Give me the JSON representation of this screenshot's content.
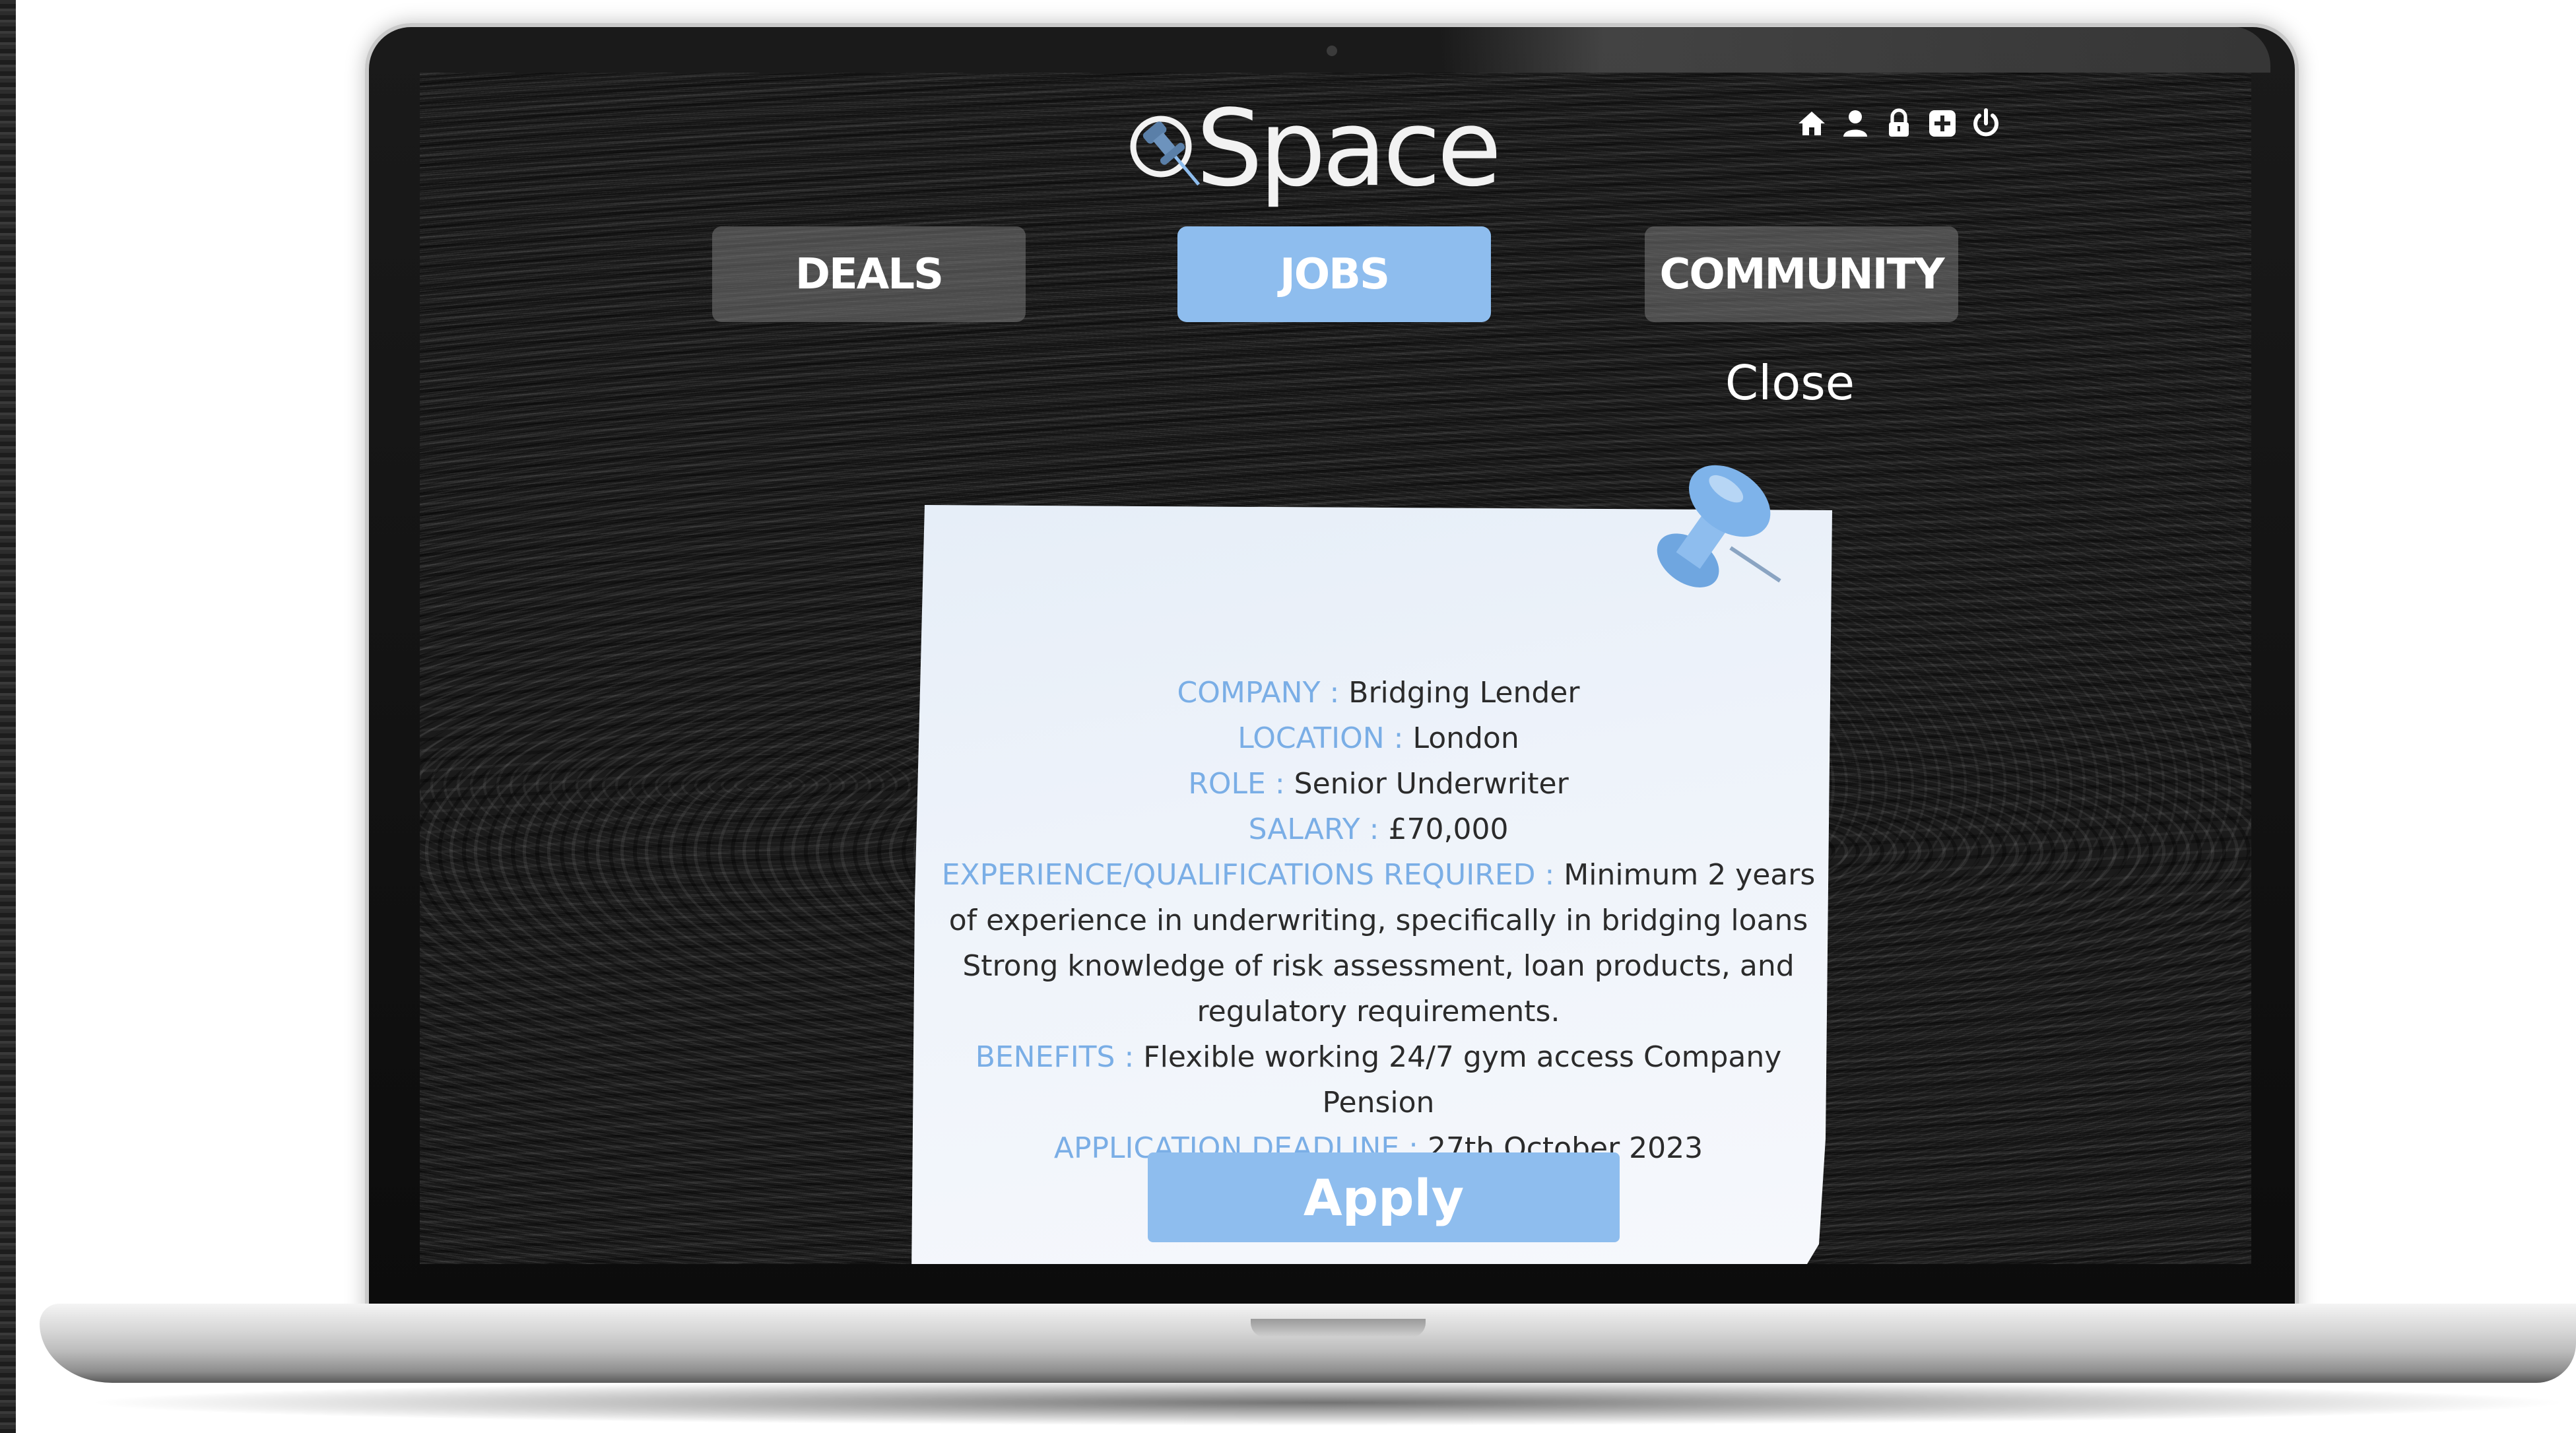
{
  "header": {
    "logo_text": "Space",
    "icons": [
      "home-icon",
      "user-icon",
      "lock-icon",
      "plus-square-icon",
      "power-icon"
    ]
  },
  "nav": {
    "tabs": [
      {
        "label": "DEALS",
        "active": false
      },
      {
        "label": "JOBS",
        "active": true
      },
      {
        "label": "COMMUNITY",
        "active": false
      }
    ],
    "close_label": "Close"
  },
  "job": {
    "company_label": "COMPANY :",
    "company": "Bridging Lender",
    "location_label": "LOCATION :",
    "location": "London",
    "role_label": "ROLE :",
    "role": "Senior Underwriter",
    "salary_label": "SALARY :",
    "salary": "£70,000",
    "experience_label": "EXPERIENCE/QUALIFICATIONS REQUIRED :",
    "experience": "Minimum 2 years of experience in underwriting, specifically in bridging loans Strong knowledge of risk assessment, loan products, and regulatory requirements.",
    "benefits_label": "BENEFITS :",
    "benefits": "Flexible working 24/7 gym access Company Pension",
    "deadline_label": "APPLICATION DEADLINE :",
    "deadline": "27th October 2023"
  },
  "apply_label": "Apply",
  "colors": {
    "accent": "#8ebdee",
    "label": "#7aaee6",
    "tab_inactive": "#6e6e6e",
    "text": "#2b2b2b"
  }
}
